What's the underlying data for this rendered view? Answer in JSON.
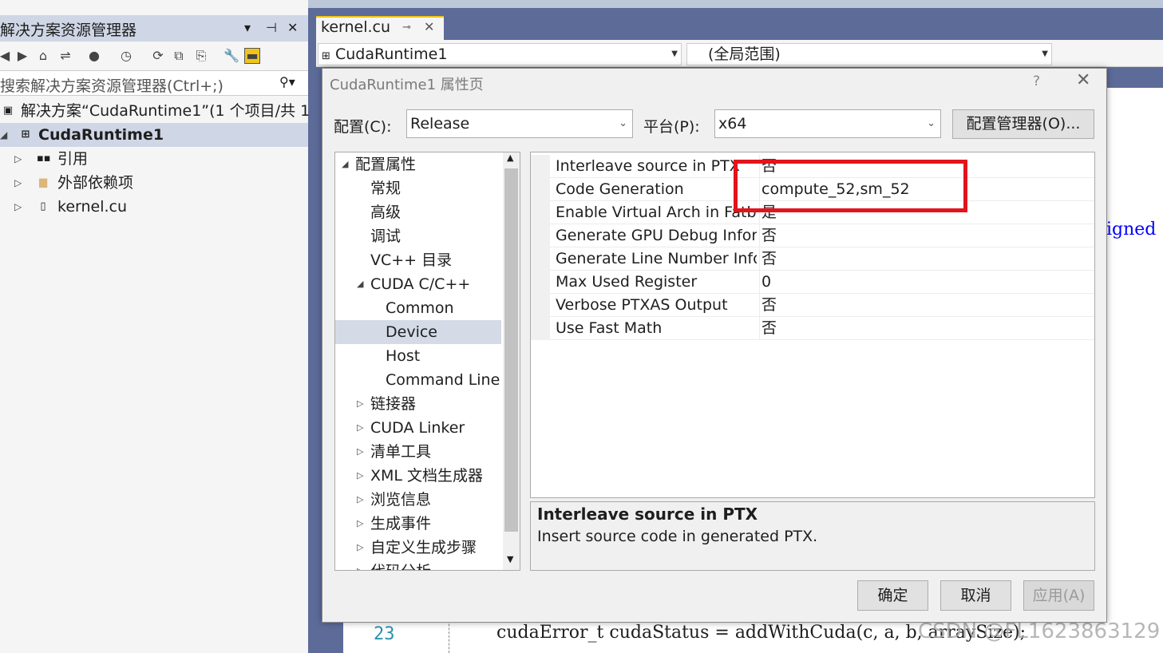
{
  "solution_explorer": {
    "title": "解决方案资源管理器",
    "controls": [
      "▾",
      "⊣",
      "✕"
    ],
    "search_placeholder": "搜索解决方案资源管理器(Ctrl+;)",
    "search_icon": "⚲▾",
    "tree": [
      {
        "label": "解决方案“CudaRuntime1”(1 个项目/共 1",
        "icon": "solution-icon"
      },
      {
        "label": "CudaRuntime1",
        "icon": "project-icon",
        "bold": true
      },
      {
        "label": "引用",
        "icon": "references-icon"
      },
      {
        "label": "外部依赖项",
        "icon": "folder-icon"
      },
      {
        "label": "kernel.cu",
        "icon": "file-icon"
      }
    ]
  },
  "editor": {
    "tab_label": "kernel.cu",
    "nav_project": "CudaRuntime1",
    "nav_scope": "(全局范围)",
    "line_number": "23",
    "code_line": "cudaError_t cudaStatus = addWithCuda(c, a, b, arraySize);",
    "side_text": "igned",
    "watermark": "CSDN @FL1623863129"
  },
  "dialog": {
    "title": "CudaRuntime1 属性页",
    "help": "?",
    "config_label": "配置(C):",
    "config_value": "Release",
    "platform_label": "平台(P):",
    "platform_value": "x64",
    "config_manager_button": "配置管理器(O)...",
    "categories": [
      {
        "label": "配置属性",
        "tri": "◢",
        "level": 0
      },
      {
        "label": "常规",
        "tri": "",
        "level": 1
      },
      {
        "label": "高级",
        "tri": "",
        "level": 1
      },
      {
        "label": "调试",
        "tri": "",
        "level": 1
      },
      {
        "label": "VC++ 目录",
        "tri": "",
        "level": 1
      },
      {
        "label": "CUDA C/C++",
        "tri": "◢",
        "level": 1
      },
      {
        "label": "Common",
        "tri": "",
        "level": 2
      },
      {
        "label": "Device",
        "tri": "",
        "level": 2,
        "selected": true
      },
      {
        "label": "Host",
        "tri": "",
        "level": 2
      },
      {
        "label": "Command Line",
        "tri": "",
        "level": 2
      },
      {
        "label": "链接器",
        "tri": "▷",
        "level": 1
      },
      {
        "label": "CUDA Linker",
        "tri": "▷",
        "level": 1
      },
      {
        "label": "清单工具",
        "tri": "▷",
        "level": 1
      },
      {
        "label": "XML 文档生成器",
        "tri": "▷",
        "level": 1
      },
      {
        "label": "浏览信息",
        "tri": "▷",
        "level": 1
      },
      {
        "label": "生成事件",
        "tri": "▷",
        "level": 1
      },
      {
        "label": "自定义生成步骤",
        "tri": "▷",
        "level": 1
      },
      {
        "label": "代码分析",
        "tri": "▷",
        "level": 1
      }
    ],
    "properties": [
      {
        "name": "Interleave source in PTX",
        "value": "否"
      },
      {
        "name": "Code Generation",
        "value": "compute_52,sm_52"
      },
      {
        "name": "Enable Virtual Arch in Fatb",
        "value": "是"
      },
      {
        "name": "Generate GPU Debug Infor",
        "value": "否"
      },
      {
        "name": "Generate Line Number Info",
        "value": "否"
      },
      {
        "name": "Max Used Register",
        "value": "0"
      },
      {
        "name": "Verbose PTXAS Output",
        "value": "否"
      },
      {
        "name": "Use Fast Math",
        "value": "否"
      }
    ],
    "description_title": "Interleave source in PTX",
    "description_text": "Insert source code in generated PTX.",
    "ok_button": "确定",
    "cancel_button": "取消",
    "apply_button": "应用(A)",
    "highlight_color": "#e3141b"
  }
}
